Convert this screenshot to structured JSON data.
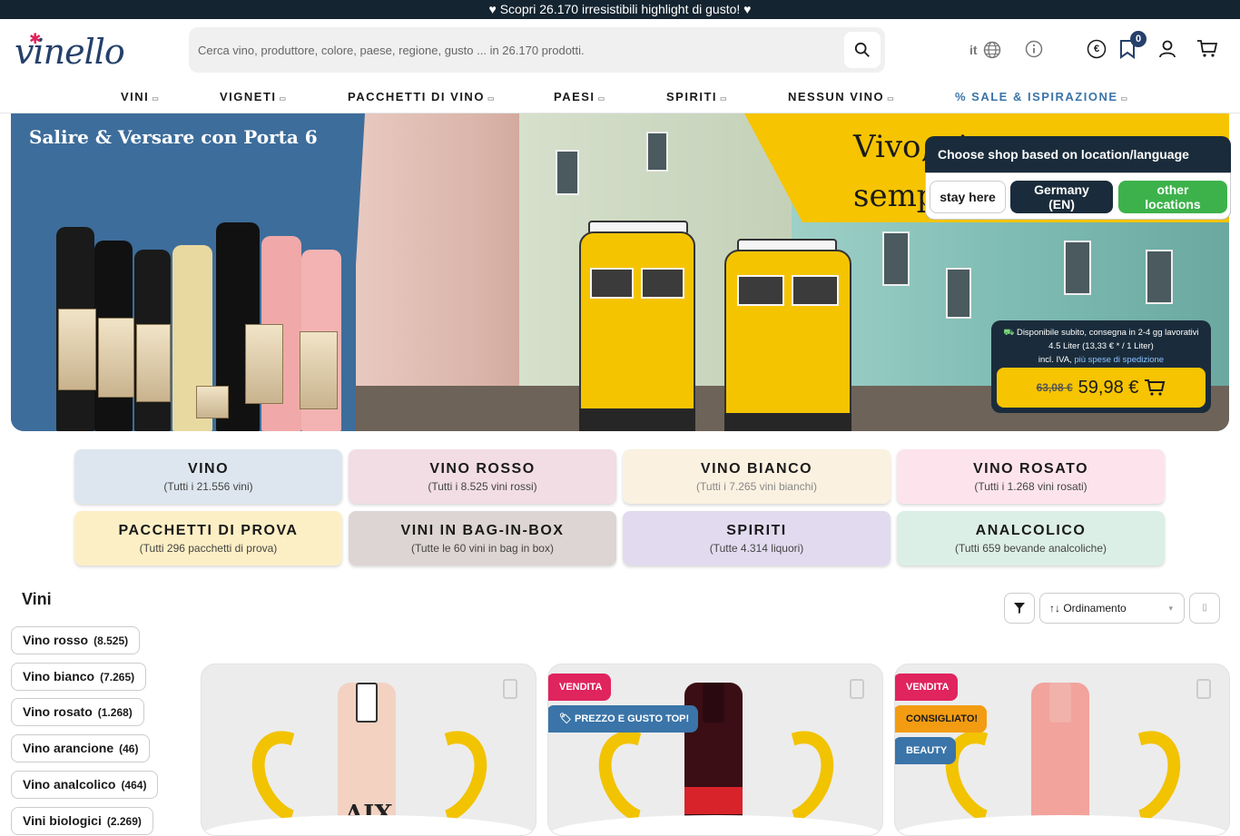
{
  "topbar": {
    "text": "♥ Scopri 26.170 irresistibili highlight di gusto! ♥"
  },
  "header": {
    "logo": "vinello",
    "search_placeholder": "Cerca vino, produttore, colore, paese, regione, gusto ... in 26.170 prodotti.",
    "language": "it",
    "currency": "€",
    "wishlist_count": "0"
  },
  "nav": {
    "items": [
      "VINI",
      "VIGNETI",
      "PACCHETTI DI VINO",
      "PAESI",
      "SPIRITI",
      "NESSUN VINO",
      "% SALE & ISPIRAZIONE"
    ]
  },
  "hero": {
    "title": "Salire & Versare con Porta 6",
    "slogan": "Vivo, vigoroso e sempre",
    "availability": "Disponibile subito, consegna in 2-4 gg lavorativi",
    "volume": "4.5 Liter (13,33 € * / 1 Liter)",
    "vat": "incl. IVA,",
    "shipping_link": "più spese di spedizione",
    "old_price": "63,08 €",
    "new_price": "59,98 €"
  },
  "popup": {
    "title": "Choose shop based on location/language",
    "stay": "stay here",
    "germany": "Germany (EN)",
    "other": "other locations"
  },
  "categories": [
    {
      "title": "VINO",
      "sub": "(Tutti i 21.556 vini)",
      "color": "#dde6ee"
    },
    {
      "title": "VINO ROSSO",
      "sub": "(Tutti i 8.525 vini rossi)",
      "color": "#f1dde3"
    },
    {
      "title": "VINO BIANCO",
      "sub": "(Tutti i 7.265 vini bianchi)",
      "color": "#fbf1e1"
    },
    {
      "title": "VINO ROSATO",
      "sub": "(Tutti i 1.268 vini rosati)",
      "color": "#fde4ec"
    },
    {
      "title": "PACCHETTI DI PROVA",
      "sub": "(Tutti 296 pacchetti di prova)",
      "color": "#fdefc5"
    },
    {
      "title": "VINI IN BAG-IN-BOX",
      "sub": "(Tutte le 60 vini in bag in box)",
      "color": "#ddd5d3"
    },
    {
      "title": "SPIRITI",
      "sub": "(Tutte 4.314 liquori)",
      "color": "#e2dbef"
    },
    {
      "title": "ANALCOLICO",
      "sub": "(Tutti 659 bevande analcoliche)",
      "color": "#dcefe6"
    }
  ],
  "listing": {
    "title": "Vini",
    "sort_label": "↑↓ Ordinamento"
  },
  "chips": [
    {
      "label": "Vino rosso",
      "count": "(8.525)"
    },
    {
      "label": "Vino bianco",
      "count": "(7.265)"
    },
    {
      "label": "Vino rosato",
      "count": "(1.268)"
    },
    {
      "label": "Vino arancione",
      "count": "(46)"
    },
    {
      "label": "Vino analcolico",
      "count": "(464)"
    },
    {
      "label": "Vini biologici",
      "count": "(2.269)"
    }
  ],
  "cards": [
    {
      "tags": []
    },
    {
      "tags": [
        "VENDITA",
        "PREZZO E GUSTO TOP!"
      ]
    },
    {
      "tags": [
        "VENDITA",
        "CONSIGLIATO!",
        "BEAUTY"
      ]
    }
  ],
  "product_labels": {
    "card1_bottle": "AIX"
  }
}
